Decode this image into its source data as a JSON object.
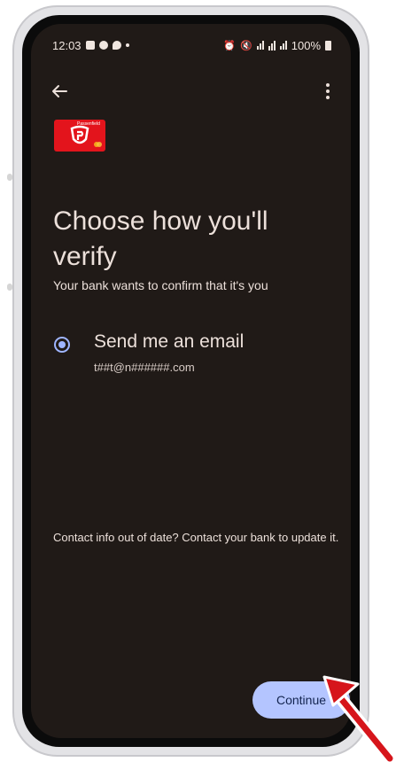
{
  "status_bar": {
    "time": "12:03",
    "battery_text": "100%"
  },
  "app_bar": {
    "back_icon": "arrow-back-icon",
    "menu_icon": "more-vert-icon"
  },
  "card": {
    "brand_text": "Passenfield",
    "accent_color": "#e3141c"
  },
  "main": {
    "title": "Choose how you'll verify",
    "subtitle": "Your bank wants to confirm that it's you",
    "option": {
      "label": "Send me an email",
      "detail": "t##t@n######.com",
      "selected": true
    },
    "contact_note": "Contact info out of date? Contact your bank to update it."
  },
  "footer": {
    "continue_label": "Continue",
    "button_color": "#b4c5ff"
  },
  "annotation": {
    "icon": "red-arrow-icon",
    "color": "#d6151b"
  }
}
